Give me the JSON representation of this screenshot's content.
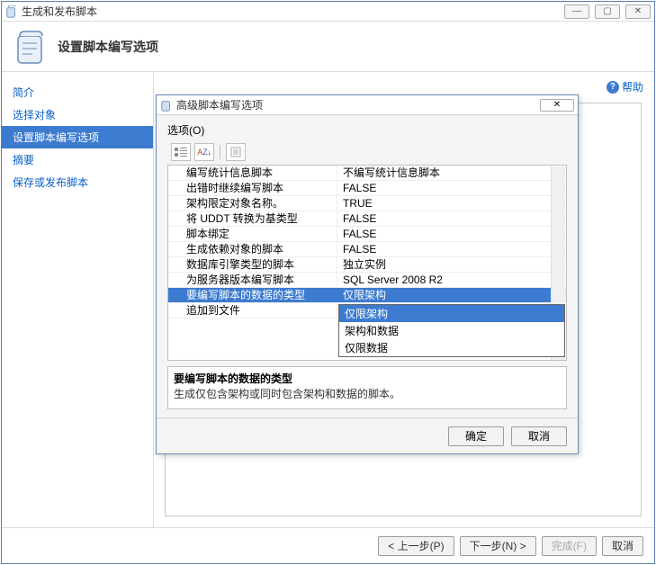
{
  "main_window": {
    "title": "生成和发布脚本",
    "header_title": "设置脚本编写选项"
  },
  "sidebar": {
    "items": [
      {
        "label": "简介"
      },
      {
        "label": "选择对象"
      },
      {
        "label": "设置脚本编写选项"
      },
      {
        "label": "摘要"
      },
      {
        "label": "保存或发布脚本"
      }
    ]
  },
  "help_label": "帮助",
  "footer": {
    "prev": "< 上一步(P)",
    "next": "下一步(N) >",
    "finish": "完成(F)",
    "cancel": "取消",
    "watermark": ""
  },
  "dialog": {
    "title": "高级脚本编写选项",
    "section_label": "选项(O)",
    "props": [
      {
        "name": "编写统计信息脚本",
        "value": "不编写统计信息脚本"
      },
      {
        "name": "出错时继续编写脚本",
        "value": "FALSE"
      },
      {
        "name": "架构限定对象名称。",
        "value": "TRUE"
      },
      {
        "name": "将 UDDT 转换为基类型",
        "value": "FALSE"
      },
      {
        "name": "脚本绑定",
        "value": "FALSE"
      },
      {
        "name": "生成依赖对象的脚本",
        "value": "FALSE"
      },
      {
        "name": "数据库引擎类型的脚本",
        "value": "独立实例"
      },
      {
        "name": "为服务器版本编写脚本",
        "value": "SQL Server 2008 R2"
      },
      {
        "name": "要编写脚本的数据的类型",
        "value": "仅限架构"
      },
      {
        "name": "追加到文件",
        "value": ""
      }
    ],
    "dropdown_options": [
      "仅限架构",
      "架构和数据",
      "仅限数据"
    ],
    "desc": {
      "title": "要编写脚本的数据的类型",
      "text": "生成仅包含架构或同时包含架构和数据的脚本。"
    },
    "ok": "确定",
    "cancel": "取消"
  }
}
